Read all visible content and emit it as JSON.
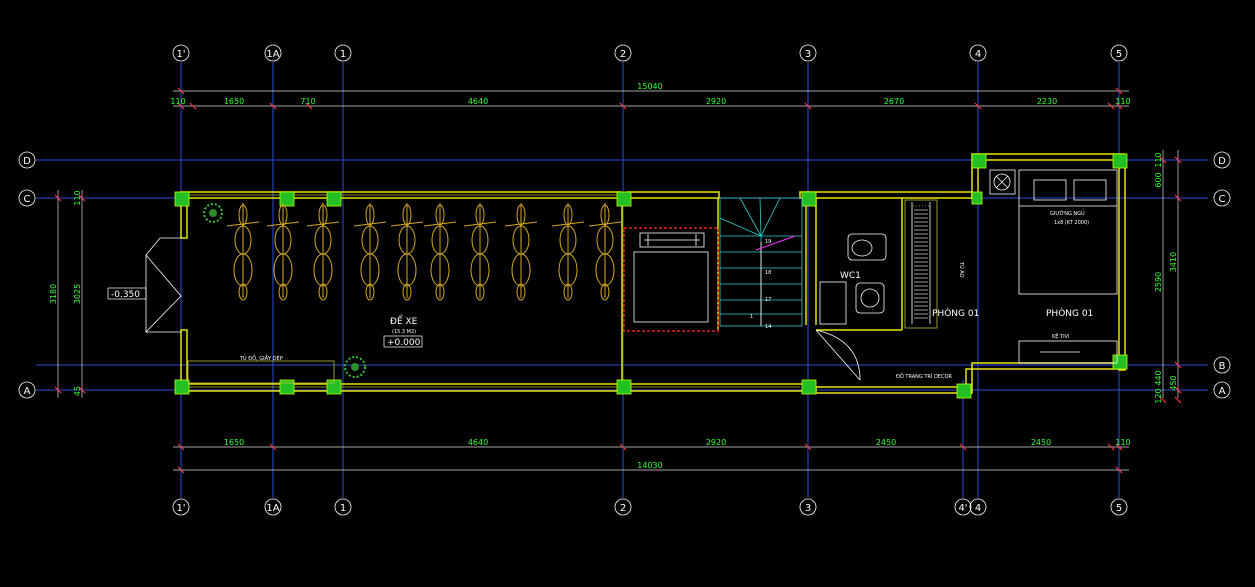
{
  "axes": {
    "vertical": [
      "1'",
      "1A",
      "1",
      "2",
      "3",
      "4",
      "5"
    ],
    "bottom_extra": "4'",
    "horizontal": [
      "D",
      "C",
      "B",
      "A"
    ]
  },
  "dims": {
    "overall_top": "15040",
    "top": [
      "110",
      "1650",
      "710",
      "4640",
      "2920",
      "2670",
      "2230",
      "110"
    ],
    "overall_bottom": "14030",
    "bottom": [
      "1650",
      "4640",
      "2920",
      "2450",
      "2450",
      "110"
    ],
    "right": [
      "110",
      "600",
      "2590",
      "440",
      "120"
    ],
    "right_total": "3410",
    "right_partial": "450",
    "left_outer": "3180",
    "left_inner": "3025",
    "left_small": [
      "110",
      "45"
    ]
  },
  "rooms": {
    "parking": "ĐỂ XE",
    "parking_sub": "(15.3 M2)",
    "level_parking": "+0.000",
    "level_out": "-0.350",
    "wc": "WC1",
    "room_left": "PHÒNG 01",
    "room_right": "PHÒNG 01",
    "bed": "GIƯỜNG NGỦ",
    "bed_size": "1x8 (KT 2000)",
    "wardrobe": "TỦ ÁO",
    "tv": "KỆ TIVI",
    "shoe_cabinet": "TỦ ĐỒ, GIẦY DÉP",
    "decor": "ĐỒ TRANG TRÍ DECOR"
  },
  "stair_numbers": [
    "19",
    "18",
    "17",
    "1",
    "14"
  ]
}
